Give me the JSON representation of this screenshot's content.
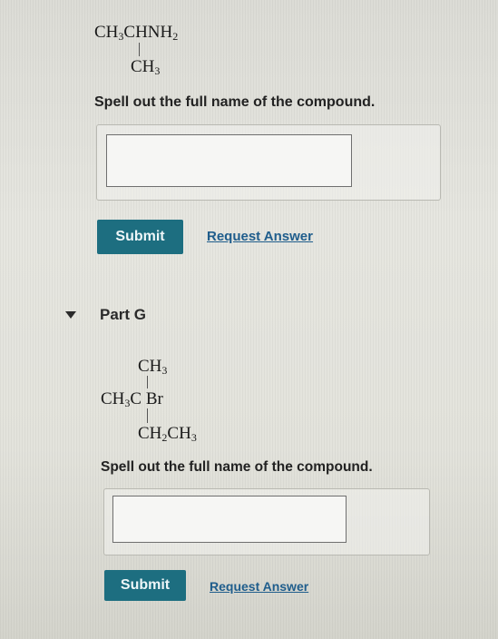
{
  "part_f": {
    "structure": {
      "main_chain": [
        "CH",
        "3",
        "CHNH",
        "2"
      ],
      "branch": [
        "CH",
        "3"
      ]
    },
    "question": "Spell out the full name of the compound.",
    "answer_value": "",
    "submit_label": "Submit",
    "request_answer_label": "Request Answer"
  },
  "part_g": {
    "title": "Part G",
    "structure": {
      "top_branch": [
        "CH",
        "3"
      ],
      "main_chain": [
        "CH",
        "3",
        "C",
        "Br"
      ],
      "bottom_branch": [
        "CH",
        "2",
        "CH",
        "3"
      ]
    },
    "question": "Spell out the full name of the compound.",
    "answer_value": "",
    "submit_label": "Submit",
    "request_answer_label": "Request Answer"
  },
  "icons": {
    "part_toggle": "caret-down-icon"
  }
}
